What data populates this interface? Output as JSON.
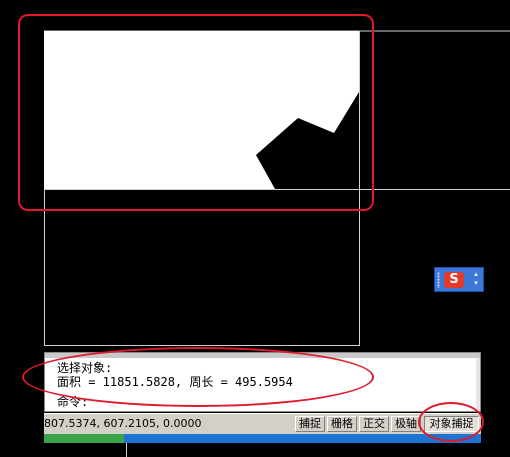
{
  "drawing": {
    "icons": {
      "ime_logo": "sogou-ime-icon",
      "ime_menu": "ime-menu-arrows-icon"
    }
  },
  "ime": {
    "logo_text": "S",
    "arrows": "▴\n▾"
  },
  "command_window": {
    "line1": "选择对象:",
    "line2": "面积 = 11851.5828, 周长 = 495.5954",
    "line3": "命令:"
  },
  "status_bar": {
    "coordinates": "807.5374, 607.2105, 0.0000",
    "toggles": [
      {
        "label": "捕捉",
        "active": false
      },
      {
        "label": "栅格",
        "active": false
      },
      {
        "label": "正交",
        "active": false
      },
      {
        "label": "极轴",
        "active": false
      },
      {
        "label": "对象捕捉",
        "active": true
      }
    ]
  },
  "colors": {
    "background": "#000000",
    "white_region": "#ffffff",
    "annotation": "#e0192b",
    "status_bar": "#d4d0c8",
    "taskbar": "#1e74d3"
  }
}
